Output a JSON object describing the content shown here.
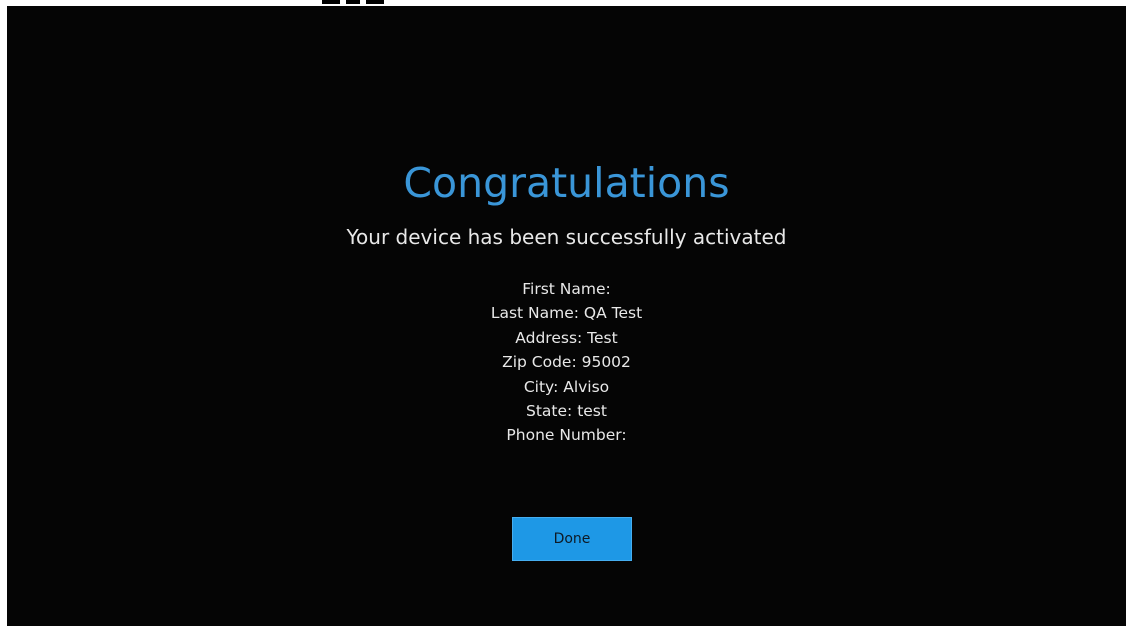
{
  "activation": {
    "title": "Congratulations",
    "message": "Your device has been successfully activated",
    "details": [
      "First Name:",
      "Last Name: QA Test",
      "Address: Test",
      "Zip Code: 95002",
      "City: Alviso",
      "State: test",
      "Phone Number:"
    ],
    "done_label": "Done"
  },
  "colors": {
    "background": "#050505",
    "title": "#3a96d8",
    "text": "#e8e8e8",
    "button": "#1e98e6"
  }
}
